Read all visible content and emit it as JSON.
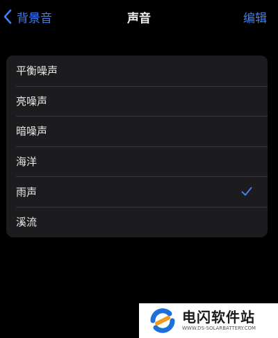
{
  "nav": {
    "back_label": "背景音",
    "title": "声音",
    "edit_label": "编辑"
  },
  "sounds": {
    "items": [
      {
        "label": "平衡噪声",
        "selected": false
      },
      {
        "label": "亮噪声",
        "selected": false
      },
      {
        "label": "暗噪声",
        "selected": false
      },
      {
        "label": "海洋",
        "selected": false
      },
      {
        "label": "雨声",
        "selected": true
      },
      {
        "label": "溪流",
        "selected": false
      }
    ]
  },
  "watermark": {
    "name": "电闪软件站",
    "url": "WWW.DS-SOLARBATTERY.COM"
  },
  "colors": {
    "background": "#000000",
    "card": "#1c1c1e",
    "accent": "#3f7ff6",
    "logo_blue": "#1e6fd9",
    "logo_orange": "#f39a1e"
  },
  "icons": {
    "back": "chevron-left-icon",
    "selected": "checkmark-icon",
    "logo": "ds-logo-icon"
  }
}
